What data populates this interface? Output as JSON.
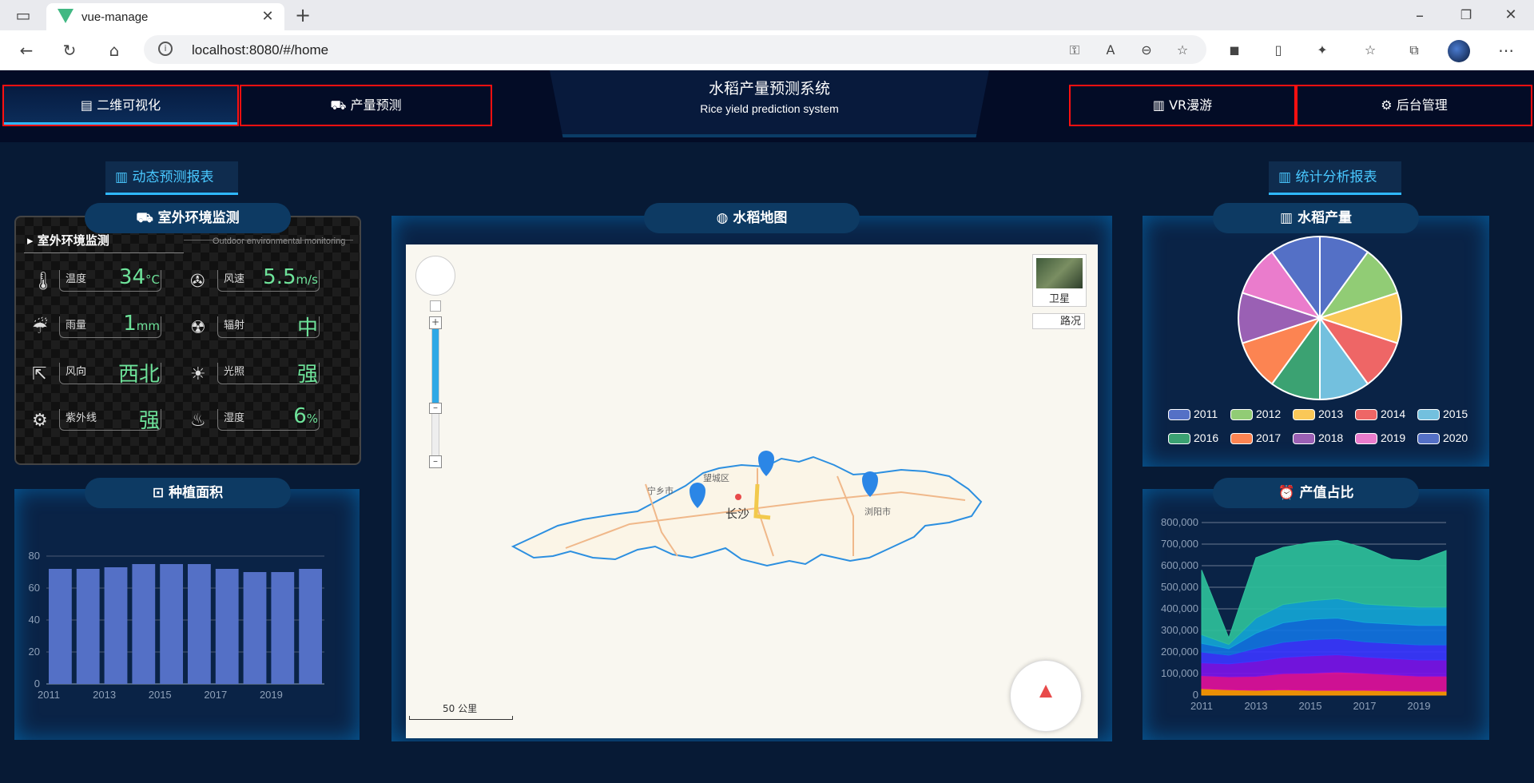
{
  "browser": {
    "tab_title": "vue-manage",
    "url": "localhost:8080/#/home"
  },
  "header": {
    "nav_left": [
      {
        "label": "二维可视化",
        "icon": "document-icon"
      },
      {
        "label": "产量预测",
        "icon": "truck-icon"
      }
    ],
    "title_zh": "水稻产量预测系统",
    "title_en": "Rice yield prediction system",
    "nav_right": [
      {
        "label": "VR漫游",
        "icon": "bar-chart-icon"
      },
      {
        "label": "后台管理",
        "icon": "gear-icon"
      }
    ]
  },
  "report_buttons": {
    "left": "动态预测报表",
    "right": "统计分析报表"
  },
  "env_panel": {
    "title": "室外环境监测",
    "header_zh": "室外环境监测",
    "header_en": "Outdoor environmental monitoring",
    "items": [
      {
        "label": "温度",
        "value": "34",
        "unit": "°C",
        "icon": "thermometer-icon"
      },
      {
        "label": "风速",
        "value": "5.5",
        "unit": "m/s",
        "icon": "fan-icon"
      },
      {
        "label": "雨量",
        "value": "1",
        "unit": "mm",
        "icon": "rain-icon"
      },
      {
        "label": "辐射",
        "value": "中",
        "unit": "",
        "icon": "radiation-icon"
      },
      {
        "label": "风向",
        "value": "西北",
        "unit": "",
        "icon": "wind-direction-icon"
      },
      {
        "label": "光照",
        "value": "强",
        "unit": "",
        "icon": "sun-icon"
      },
      {
        "label": "紫外线",
        "value": "强",
        "unit": "",
        "icon": "uv-icon"
      },
      {
        "label": "湿度",
        "value": "6",
        "unit": "%",
        "icon": "humidity-icon"
      }
    ]
  },
  "planting_panel": {
    "title": "种植面积"
  },
  "map_panel": {
    "title": "水稻地图",
    "satellite_label": "卫星",
    "traffic_label": "路况",
    "scale_label": "50 公里",
    "city_labels": [
      "长沙",
      "宁乡市",
      "望城区",
      "浏阳市"
    ]
  },
  "yield_panel": {
    "title": "水稻产量"
  },
  "value_panel": {
    "title": "产值占比"
  },
  "chart_data": [
    {
      "type": "bar",
      "title": "种植面积",
      "categories": [
        "2011",
        "2012",
        "2013",
        "2014",
        "2015",
        "2016",
        "2017",
        "2018",
        "2019",
        "2020"
      ],
      "tick_labels": [
        "2011",
        "2013",
        "2015",
        "2017",
        "2019"
      ],
      "values": [
        72,
        72,
        73,
        75,
        75,
        75,
        72,
        70,
        70,
        72
      ],
      "ylim": [
        0,
        80
      ],
      "yticks": [
        0,
        20,
        40,
        60,
        80
      ],
      "color": "#5470c6"
    },
    {
      "type": "pie",
      "title": "水稻产量",
      "subtype": "rose",
      "categories": [
        "2011",
        "2012",
        "2013",
        "2014",
        "2015",
        "2016",
        "2017",
        "2018",
        "2019",
        "2020"
      ],
      "values": [
        1,
        1,
        1,
        1,
        1,
        1,
        1,
        1,
        1,
        1
      ],
      "colors": [
        "#5470c6",
        "#91cc75",
        "#fac858",
        "#ee6666",
        "#73c0de",
        "#3ba272",
        "#fc8452",
        "#9a60b4",
        "#ea7ccc",
        "#5470c6"
      ],
      "legend_position": "bottom"
    },
    {
      "type": "area",
      "title": "产值占比",
      "stacked": true,
      "x": [
        "2011",
        "2012",
        "2013",
        "2014",
        "2015",
        "2016",
        "2017",
        "2018",
        "2019",
        "2020"
      ],
      "tick_labels": [
        "2011",
        "2013",
        "2015",
        "2017",
        "2019"
      ],
      "yticks": [
        0,
        100000,
        200000,
        300000,
        400000,
        500000,
        600000,
        700000,
        800000
      ],
      "ytick_labels": [
        "0",
        "100,000",
        "200,000",
        "300,000",
        "400,000",
        "500,000",
        "600,000",
        "700,000",
        "800,000"
      ],
      "ylim": [
        0,
        800000
      ],
      "series": [
        {
          "values": [
            30000,
            25000,
            22000,
            25000,
            22000,
            22000,
            22000,
            20000,
            18000,
            18000
          ],
          "color": "#ff9900"
        },
        {
          "values": [
            60000,
            60000,
            65000,
            75000,
            80000,
            85000,
            80000,
            75000,
            70000,
            70000
          ],
          "color": "#e0109a"
        },
        {
          "values": [
            60000,
            60000,
            70000,
            75000,
            80000,
            80000,
            75000,
            75000,
            75000,
            75000
          ],
          "color": "#7b14e8"
        },
        {
          "values": [
            50000,
            40000,
            60000,
            70000,
            75000,
            75000,
            70000,
            70000,
            70000,
            70000
          ],
          "color": "#3a37ff"
        },
        {
          "values": [
            40000,
            30000,
            70000,
            90000,
            95000,
            95000,
            90000,
            90000,
            90000,
            90000
          ],
          "color": "#1173e0"
        },
        {
          "values": [
            40000,
            20000,
            70000,
            85000,
            85000,
            90000,
            85000,
            85000,
            85000,
            85000
          ],
          "color": "#13a6d6"
        },
        {
          "values": [
            300000,
            30000,
            280000,
            265000,
            270000,
            270000,
            260000,
            215000,
            215000,
            262000
          ],
          "color": "#2ec09a"
        }
      ]
    }
  ]
}
